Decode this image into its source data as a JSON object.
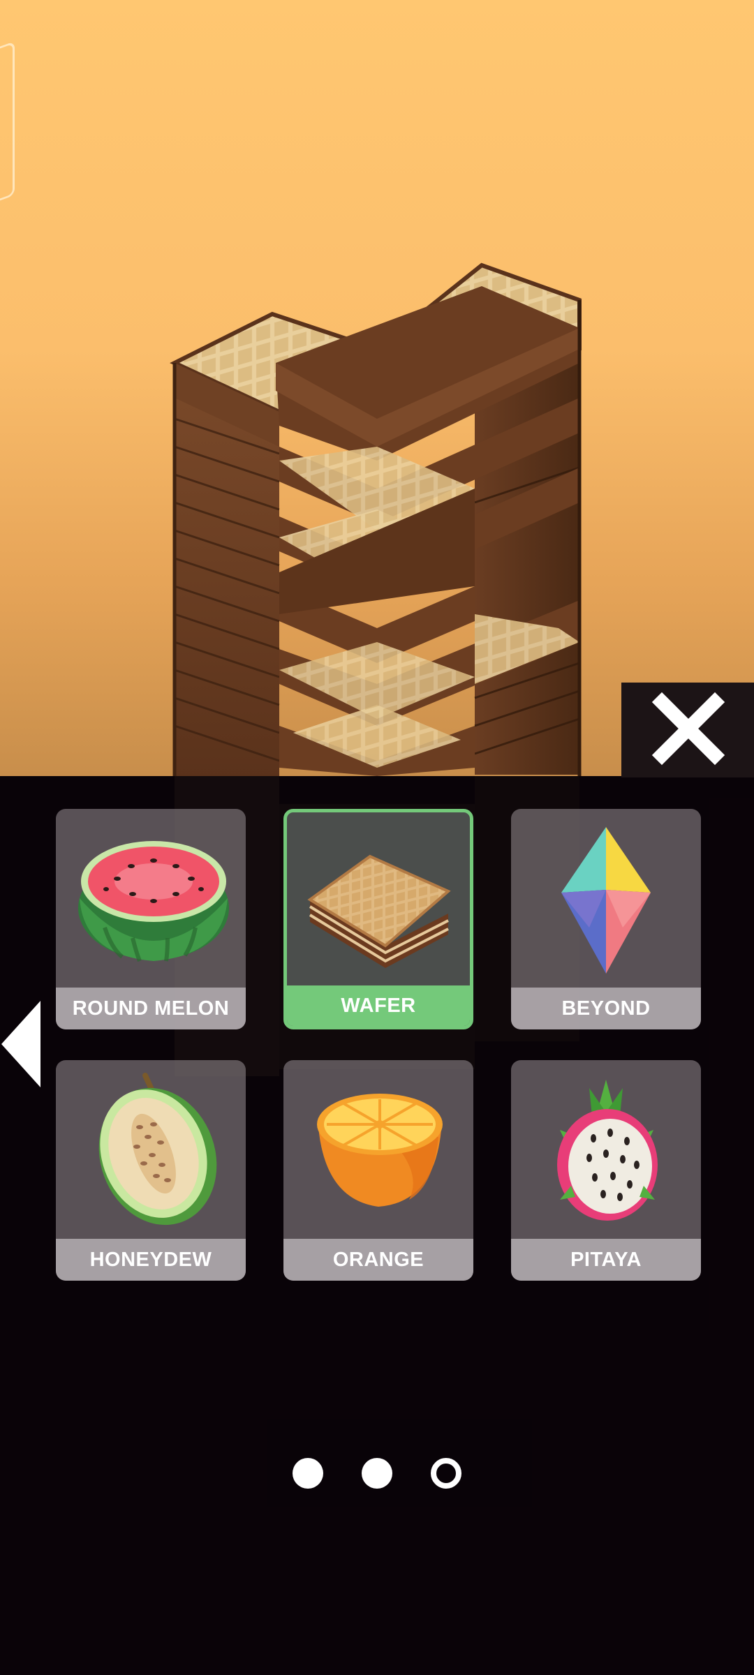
{
  "screen": "skin-select",
  "scene": {
    "tower_skin": "wafer",
    "sky_colors": [
      "#ffc771",
      "#c88e4b"
    ]
  },
  "controls": {
    "close_icon": "close-x-icon",
    "prev_icon": "triangle-left-icon"
  },
  "skins": [
    {
      "name": "ROUND MELON",
      "icon": "watermelon-half-icon",
      "selected": false
    },
    {
      "name": "WAFER",
      "icon": "wafer-icon",
      "selected": true
    },
    {
      "name": "BEYOND",
      "icon": "crystal-icon",
      "selected": false
    },
    {
      "name": "HONEYDEW",
      "icon": "honeydew-half-icon",
      "selected": false
    },
    {
      "name": "ORANGE",
      "icon": "orange-half-icon",
      "selected": false
    },
    {
      "name": "PITAYA",
      "icon": "pitaya-half-icon",
      "selected": false
    }
  ],
  "pager": {
    "pages": 3,
    "current_page": 3
  },
  "colors": {
    "selected_accent": "#74c97a",
    "tile_bg": "#78706f",
    "label_bg": "#bcb6ba"
  }
}
